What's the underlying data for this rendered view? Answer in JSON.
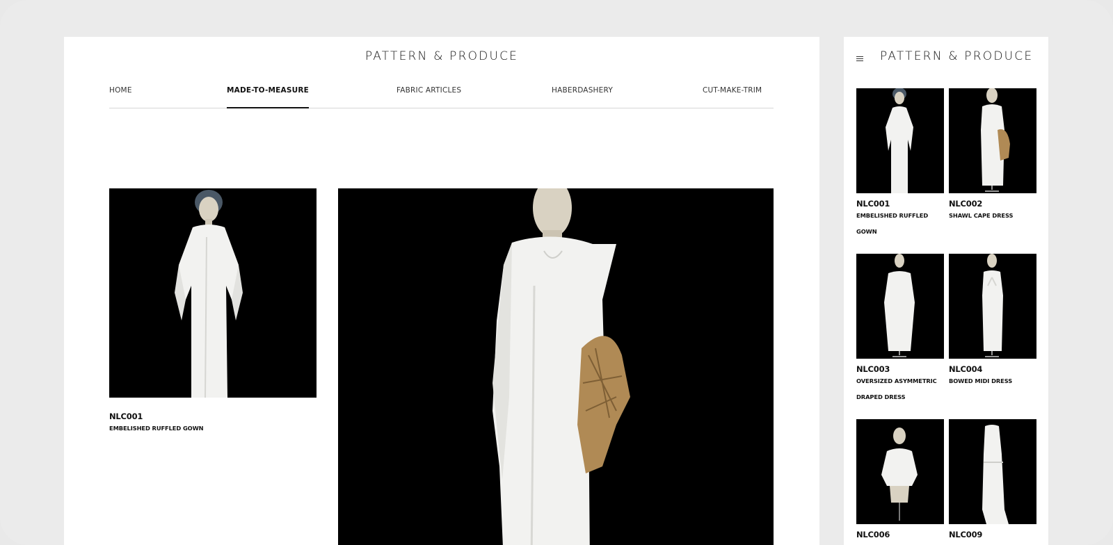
{
  "brand": {
    "desktop_logo": "PATTERN & PRODUCE",
    "mobile_logo": "PATTERN & PRODUCE"
  },
  "nav": {
    "items": [
      {
        "label": "HOME"
      },
      {
        "label": "MADE-TO-MEASURE",
        "active": true
      },
      {
        "label": "FABRIC ARTICLES"
      },
      {
        "label": "HABERDASHERY"
      },
      {
        "label": "CUT-MAKE-TRIM"
      }
    ]
  },
  "featured": {
    "code": "NLC001",
    "name": "EMBELISHED RUFFLED GOWN"
  },
  "mobile_products": [
    {
      "code": "NLC001",
      "name_line1": "EMBELISHED RUFFLED",
      "name_line2": "GOWN",
      "image": "white-ruffled-gown-photo"
    },
    {
      "code": "NLC002",
      "name_line1": "SHAWL CAPE DRESS",
      "name_line2": "",
      "image": "shawl-cape-dress-photo"
    },
    {
      "code": "NLC003",
      "name_line1": "OVERSIZED ASYMMETRIC",
      "name_line2": "DRAPED DRESS",
      "image": "asymmetric-draped-dress-photo"
    },
    {
      "code": "NLC004",
      "name_line1": "BOWED MIDI DRESS",
      "name_line2": "",
      "image": "bowed-midi-dress-photo"
    },
    {
      "code": "NLC006",
      "name_line1": "",
      "name_line2": "",
      "image": "cape-top-photo"
    },
    {
      "code": "NLC009",
      "name_line1": "",
      "name_line2": "",
      "image": "tie-waist-robe-photo"
    }
  ],
  "colors": {
    "background": "#ebebeb",
    "panel": "#ffffff",
    "photo_bg": "#000000",
    "garment": "#f2f2f0",
    "mannequin": "#d9d2c2",
    "shawl": "#b08a55"
  }
}
